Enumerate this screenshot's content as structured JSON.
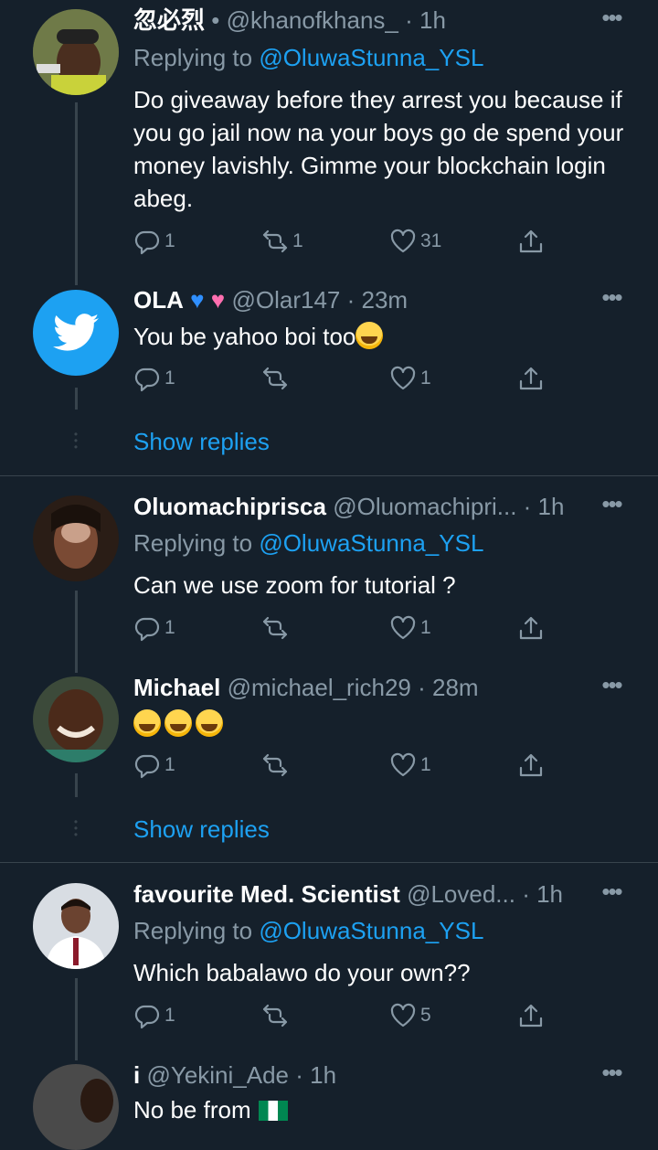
{
  "tweets": [
    {
      "name": "忽必烈",
      "separator": "•",
      "handle": "@khanofkhans_",
      "time": "· 1h",
      "replying_label": "Replying to",
      "replying_mention": "@OluwaStunna_YSL",
      "body": "Do giveaway before they arrest you because if you go jail now na your boys go de spend your money lavishly. Gimme your blockchain login abeg.",
      "reply_count": "1",
      "retweet_count": "1",
      "like_count": "31"
    },
    {
      "name": "OLA",
      "handle": "@Olar147",
      "time": "· 23m",
      "body": "You be yahoo boi too",
      "reply_count": "1",
      "retweet_count": "",
      "like_count": "1",
      "show_replies": "Show replies"
    },
    {
      "name": "Oluomachiprisca",
      "handle": "@Oluomachipri...",
      "time": "· 1h",
      "replying_label": "Replying to",
      "replying_mention": "@OluwaStunna_YSL",
      "body": "Can we use zoom for tutorial ?",
      "reply_count": "1",
      "retweet_count": "",
      "like_count": "1"
    },
    {
      "name": "Michael",
      "handle": "@michael_rich29",
      "time": "· 28m",
      "body": "",
      "reply_count": "1",
      "retweet_count": "",
      "like_count": "1",
      "show_replies": "Show replies"
    },
    {
      "name": "favourite Med. Scientist",
      "handle": "@Loved...",
      "time": "· 1h",
      "replying_label": "Replying to",
      "replying_mention": "@OluwaStunna_YSL",
      "body": "Which babalawo do your own??",
      "reply_count": "1",
      "retweet_count": "",
      "like_count": "5"
    },
    {
      "name": "i",
      "handle": "@Yekini_Ade",
      "time": "· 1h",
      "body": "No be from"
    }
  ],
  "more_glyph": "•••",
  "colors": {
    "background": "#15202b",
    "secondary_text": "#8899a6",
    "accent": "#1da1f2",
    "divider": "#38444d"
  }
}
